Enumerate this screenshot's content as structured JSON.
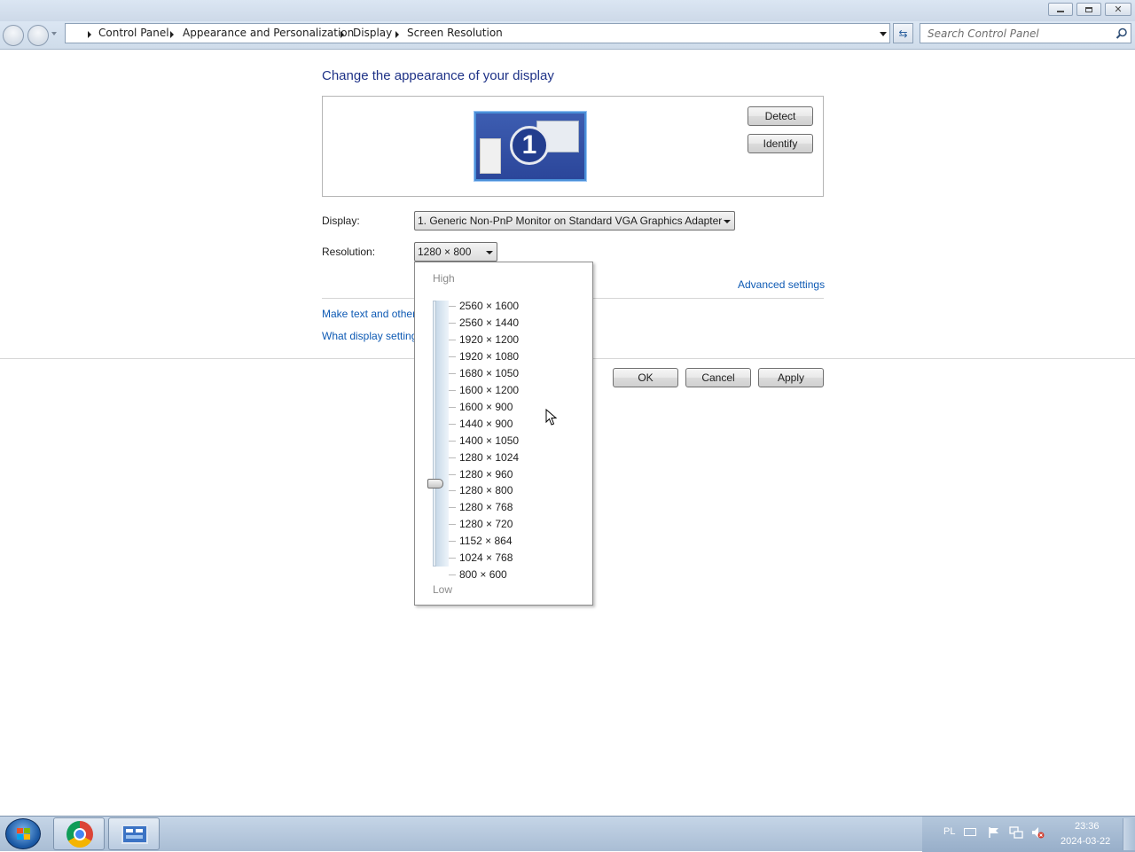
{
  "navigation": {
    "breadcrumbs": [
      "Control Panel",
      "Appearance and Personalization",
      "Display",
      "Screen Resolution"
    ],
    "search_placeholder": "Search Control Panel"
  },
  "main": {
    "title": "Change the appearance of your display",
    "monitor_number": "1",
    "detect_label": "Detect",
    "identify_label": "Identify",
    "display_label": "Display:",
    "display_value": "1. Generic Non-PnP Monitor on Standard VGA Graphics Adapter",
    "resolution_label": "Resolution:",
    "resolution_value": "1280 × 800",
    "advanced_link": "Advanced settings",
    "text_size_link": "Make text and other",
    "display_settings_link": "What display setting",
    "ok_label": "OK",
    "cancel_label": "Cancel",
    "apply_label": "Apply"
  },
  "dropdown": {
    "high_label": "High",
    "low_label": "Low",
    "selected": "1280 × 800",
    "options": [
      "2560 × 1600",
      "2560 × 1440",
      "1920 × 1200",
      "1920 × 1080",
      "1680 × 1050",
      "1600 × 1200",
      "1600 × 900",
      "1440 × 900",
      "1400 × 1050",
      "1280 × 1024",
      "1280 × 960",
      "1280 × 800",
      "1280 × 768",
      "1280 × 720",
      "1152 × 864",
      "1024 × 768",
      "800 × 600"
    ]
  },
  "taskbar": {
    "language": "PL",
    "time": "23:36",
    "date": "2024-03-22",
    "apps": [
      "start-orb-icon",
      "chrome-icon",
      "control-panel-icon"
    ]
  },
  "colors": {
    "title_blue": "#1e3287",
    "link_blue": "#0e5ab4",
    "monitor_blue": "#3d5db1"
  }
}
